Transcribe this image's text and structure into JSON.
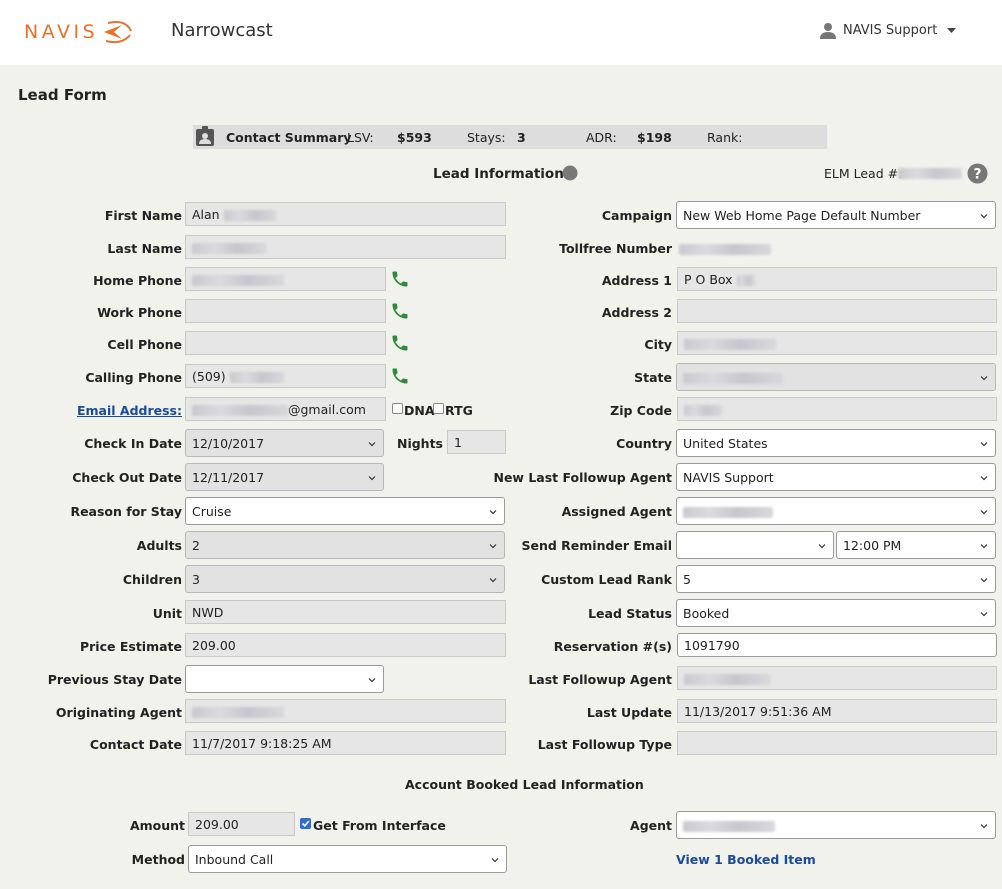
{
  "header": {
    "logo_text": "NAVIS",
    "app_name": "Narrowcast",
    "user_name": "NAVIS Support",
    "brand_color": "#e8722c"
  },
  "page": {
    "title": "Lead Form"
  },
  "summary": {
    "label": "Contact Summary",
    "lsv_label": "LSV:",
    "lsv_value": "$593",
    "stays_label": "Stays:",
    "stays_value": "3",
    "adr_label": "ADR:",
    "adr_value": "$198",
    "rank_label": "Rank:",
    "rank_value": ""
  },
  "lead_info": {
    "title": "Lead Information",
    "elm_label": "ELM Lead #:"
  },
  "left": {
    "first_name": {
      "label": "First Name",
      "value": "Alan"
    },
    "last_name": {
      "label": "Last Name",
      "value": ""
    },
    "home_phone": {
      "label": "Home Phone",
      "value": ""
    },
    "work_phone": {
      "label": "Work Phone",
      "value": ""
    },
    "cell_phone": {
      "label": "Cell Phone",
      "value": ""
    },
    "calling_phone": {
      "label": "Calling Phone",
      "value": "(509)"
    },
    "email": {
      "label": "Email Address:",
      "value": "@gmail.com",
      "dna_label": "DNA",
      "rtg_label": "RTG"
    },
    "check_in": {
      "label": "Check In Date",
      "value": "12/10/2017"
    },
    "nights": {
      "label": "Nights",
      "value": "1"
    },
    "check_out": {
      "label": "Check Out Date",
      "value": "12/11/2017"
    },
    "reason": {
      "label": "Reason for Stay",
      "value": "Cruise"
    },
    "adults": {
      "label": "Adults",
      "value": "2"
    },
    "children": {
      "label": "Children",
      "value": "3"
    },
    "unit": {
      "label": "Unit",
      "value": "NWD"
    },
    "price": {
      "label": "Price Estimate",
      "value": "209.00"
    },
    "prev_stay": {
      "label": "Previous Stay Date",
      "value": ""
    },
    "orig_agent": {
      "label": "Originating Agent",
      "value": ""
    },
    "contact_date": {
      "label": "Contact Date",
      "value": "11/7/2017 9:18:25 AM"
    }
  },
  "right": {
    "campaign": {
      "label": "Campaign",
      "value": "New Web Home Page Default Number"
    },
    "tollfree": {
      "label": "Tollfree Number",
      "value": ""
    },
    "address1": {
      "label": "Address 1",
      "value": "P O Box"
    },
    "address2": {
      "label": "Address 2",
      "value": ""
    },
    "city": {
      "label": "City",
      "value": ""
    },
    "state": {
      "label": "State",
      "value": ""
    },
    "zip": {
      "label": "Zip Code",
      "value": ""
    },
    "country": {
      "label": "Country",
      "value": "United States"
    },
    "new_followup": {
      "label": "New Last Followup Agent",
      "value": "NAVIS Support"
    },
    "assigned": {
      "label": "Assigned Agent",
      "value": ""
    },
    "reminder": {
      "label": "Send Reminder Email",
      "date_value": "",
      "time_value": "12:00 PM"
    },
    "custom_rank": {
      "label": "Custom Lead Rank",
      "value": "5"
    },
    "lead_status": {
      "label": "Lead Status",
      "value": "Booked"
    },
    "reservation": {
      "label": "Reservation #(s)",
      "value": "1091790"
    },
    "last_followup_agent": {
      "label": "Last Followup Agent",
      "value": ""
    },
    "last_update": {
      "label": "Last Update",
      "value": "11/13/2017 9:51:36 AM"
    },
    "last_followup_type": {
      "label": "Last Followup Type",
      "value": ""
    }
  },
  "booked": {
    "title": "Account Booked Lead Information",
    "amount": {
      "label": "Amount",
      "value": "209.00"
    },
    "get_from_interface": {
      "label": "Get From Interface",
      "checked": true
    },
    "method": {
      "label": "Method",
      "value": "Inbound Call"
    },
    "agent": {
      "label": "Agent",
      "value": ""
    },
    "view_link": "View 1 Booked Item"
  },
  "icons": {
    "phone": "phone-icon",
    "help": "help-icon",
    "status": "status-dot-icon",
    "contact": "contact-card-icon",
    "user": "user-icon",
    "chevron": "chevron-down-icon"
  },
  "colors": {
    "phone_green": "#2e8b3d",
    "link_blue": "#1a4b9b",
    "status_grey": "#7a7a7a"
  }
}
